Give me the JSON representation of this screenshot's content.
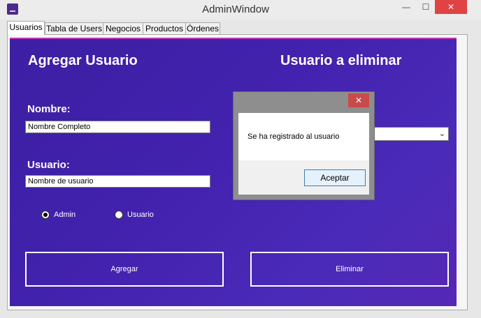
{
  "window": {
    "title": "AdminWindow",
    "minimize_glyph": "—",
    "maximize_glyph": "☐",
    "close_glyph": "✕"
  },
  "tabs": [
    {
      "label": "Usuarios",
      "active": true
    },
    {
      "label": "Tabla de Users"
    },
    {
      "label": "Negocios"
    },
    {
      "label": "Productos"
    },
    {
      "label": "Órdenes"
    }
  ],
  "add_user": {
    "heading": "Agregar Usuario",
    "name_label": "Nombre:",
    "name_value": "Nombre Completo",
    "username_label": "Usuario:",
    "username_value": "Nombre de usuario",
    "role_options": [
      {
        "label": "Admin",
        "checked": true
      },
      {
        "label": "Usuario",
        "checked": false
      }
    ],
    "add_button": "Agregar"
  },
  "delete_user": {
    "heading": "Usuario a eliminar",
    "delete_button": "Eliminar",
    "select_arrow": "⌄"
  },
  "dialog": {
    "message": "Se ha registrado al usuario",
    "ok_button": "Aceptar",
    "close_glyph": "✕"
  },
  "colors": {
    "panel_gradient_start": "#3c1fa3",
    "panel_gradient_end": "#5628b6",
    "accent_border": "#c03ab0",
    "close_red": "#e04343"
  }
}
